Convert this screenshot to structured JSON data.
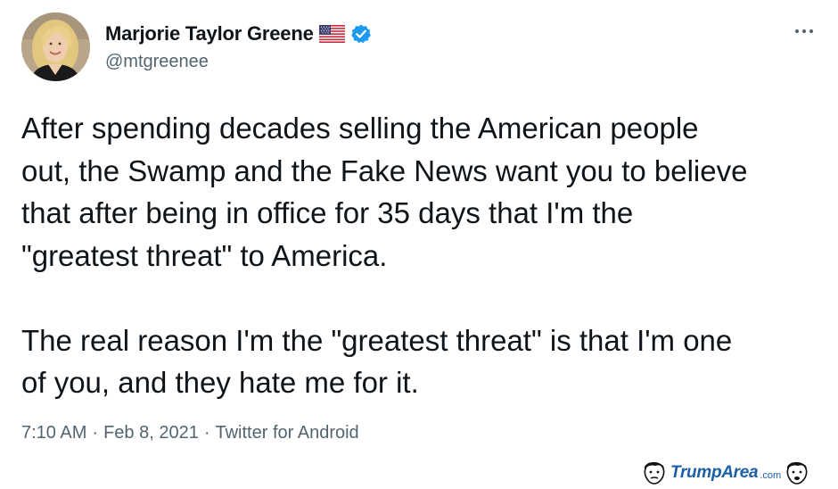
{
  "author": {
    "display_name": "Marjorie Taylor Greene",
    "handle": "@mtgreenee",
    "flag_icon": "us-flag-icon",
    "verified_icon": "verified-badge-icon",
    "verified_color": "#1d9bf0"
  },
  "tweet": {
    "paragraph_1": "After spending decades selling the American people\nout, the Swamp and the Fake News want you to believe\nthat after being in office for 35 days that I'm the\n\"greatest threat\" to America.",
    "paragraph_2": "The real reason I'm the \"greatest threat\" is that I'm one\nof you, and they hate me for it."
  },
  "meta": {
    "time": "7:10 AM",
    "separator_1": "·",
    "date": "Feb 8, 2021",
    "separator_2": "·",
    "source": "Twitter for Android"
  },
  "more_icon": "more-horizontal-icon",
  "watermark": {
    "brand": "TrumpArea",
    "suffix": ".com"
  },
  "colors": {
    "text_primary": "#0f1419",
    "text_secondary": "#536471",
    "watermark": "#1b5fa6"
  }
}
